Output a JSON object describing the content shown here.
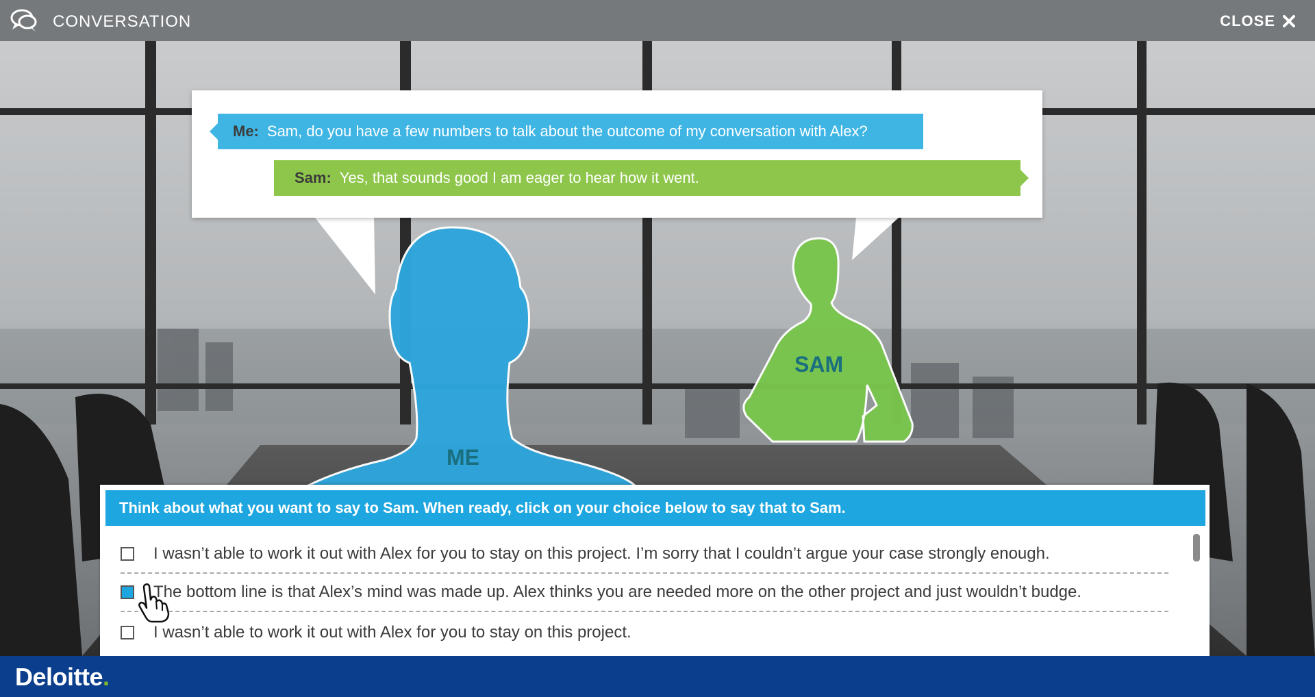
{
  "header": {
    "title": "CONVERSATION",
    "close_label": "CLOSE"
  },
  "dialogue": {
    "lines": [
      {
        "speaker": "Me:",
        "text": "Sam, do you have a few numbers to talk about the outcome of my conversation with Alex?",
        "color": "#3fb5e4"
      },
      {
        "speaker": "Sam:",
        "text": "Yes, that sounds good I am eager to hear how it went.",
        "color": "#8ec64b"
      }
    ]
  },
  "characters": {
    "me_label": "ME",
    "sam_label": "SAM"
  },
  "prompt": "Think about what you want to say to Sam. When ready, click on your choice below to say that to Sam.",
  "choices": [
    {
      "text": "I wasn’t able to work it out with Alex for you to stay on this project. I’m sorry that I couldn’t argue your case strongly enough.",
      "checked": false
    },
    {
      "text": "The bottom line is that Alex’s mind was made up. Alex thinks you are needed more on the other project and just wouldn’t budge.",
      "checked": true
    },
    {
      "text": "I wasn’t able to work it out with Alex for you to stay on this project.",
      "checked": false
    }
  ],
  "footer": {
    "brand": "Deloitte",
    "brand_dot": "."
  },
  "colors": {
    "accent_blue": "#1ea6e0",
    "me_blue": "#3fb5e4",
    "sam_green": "#8ec64b",
    "footer_navy": "#0b3e8c"
  }
}
